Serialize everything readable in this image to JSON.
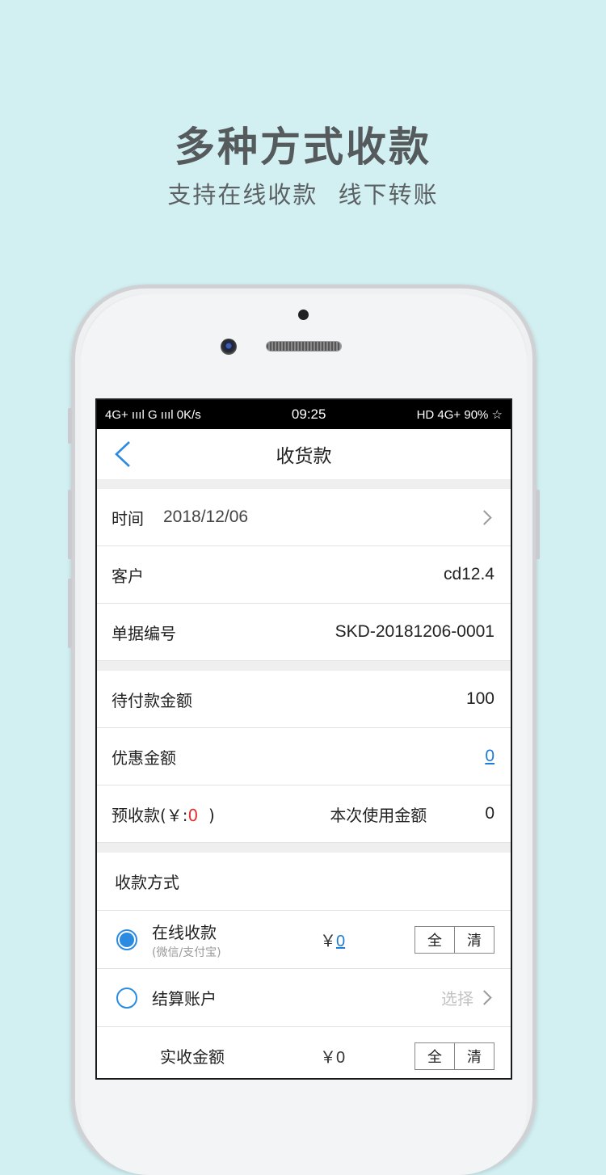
{
  "hero": {
    "title": "多种方式收款",
    "subtitle": "支持在线收款 线下转账"
  },
  "status_bar": {
    "left": "4G+ ıııl G ıııl 0K/s",
    "time": "09:25",
    "right": "HD 4G+ 90% ☆"
  },
  "nav": {
    "title": "收货款",
    "back_icon": "chevron-left-icon"
  },
  "form": {
    "time_label": "时间",
    "time_value": "2018/12/06",
    "customer_label": "客户",
    "customer_value": "cd12.4",
    "doc_no_label": "单据编号",
    "doc_no_value": "SKD-20181206-0001",
    "pending_label": "待付款金额",
    "pending_value": "100",
    "discount_label": "优惠金额",
    "discount_value": "0",
    "prepay_label_prefix": "预收款(￥:",
    "prepay_value": "0",
    "prepay_label_suffix": "  )",
    "use_amount_label": "本次使用金额",
    "use_amount_value": "0"
  },
  "payment": {
    "section_title": "收款方式",
    "online": {
      "label": "在线收款",
      "sub": "(微信/支付宝)",
      "currency": "￥",
      "amount": "0",
      "btn_all": "全",
      "btn_clear": "清",
      "selected": true
    },
    "account": {
      "label": "结算账户",
      "hint": "选择",
      "selected": false
    },
    "actual": {
      "label": "实收金额",
      "amount": "￥0",
      "btn_all": "全",
      "btn_clear": "清"
    }
  },
  "colors": {
    "background": "#d2eff2",
    "accent": "#2b8be0",
    "link": "#1e7bd8",
    "red": "#e23030"
  }
}
